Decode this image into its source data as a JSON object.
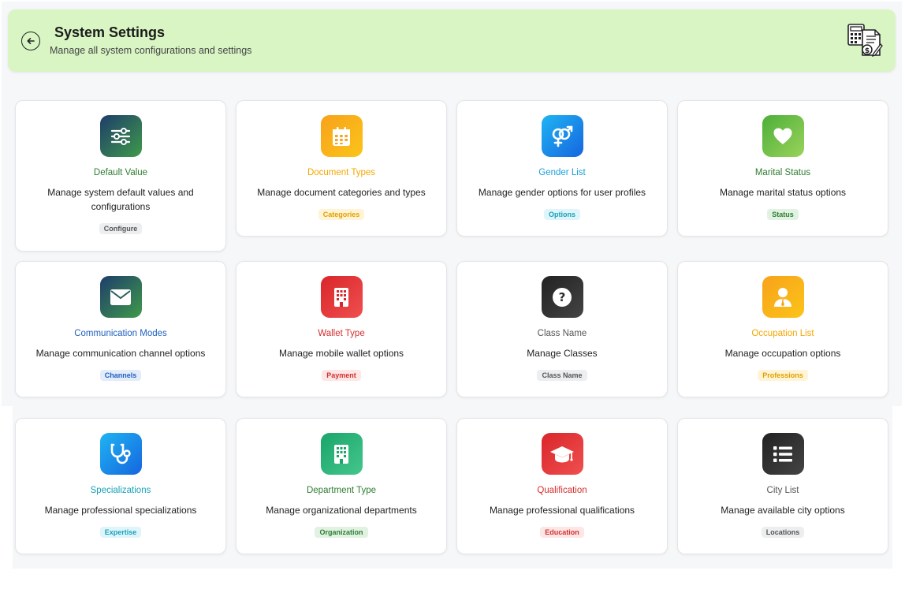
{
  "header": {
    "title": "System Settings",
    "subtitle": "Manage all system configurations and settings"
  },
  "cards": [
    {
      "title": "Default Value",
      "desc": "Manage system default values and configurations",
      "badge": "Configure",
      "color": "#2e7d32",
      "icon": "sliders-icon"
    },
    {
      "title": "Document Types",
      "desc": "Manage document categories and types",
      "badge": "Categories",
      "color": "#f5a700",
      "icon": "calendar-icon"
    },
    {
      "title": "Gender List",
      "desc": "Manage gender options for user profiles",
      "badge": "Options",
      "color": "#1aa0d8",
      "icon": "gender-icon"
    },
    {
      "title": "Marital Status",
      "desc": "Manage marital status options",
      "badge": "Status",
      "color": "#2e7d32",
      "icon": "heart-icon"
    },
    {
      "title": "Communication Modes",
      "desc": "Manage communication channel options",
      "badge": "Channels",
      "color": "#1f5fbf",
      "icon": "envelope-icon"
    },
    {
      "title": "Wallet Type",
      "desc": "Manage mobile wallet options",
      "badge": "Payment",
      "color": "#d32f2f",
      "icon": "building-icon"
    },
    {
      "title": "Class Name",
      "desc": "Manage Classes",
      "badge": "Class Name",
      "color": "#555555",
      "icon": "question-icon"
    },
    {
      "title": "Occupation List",
      "desc": "Manage occupation options",
      "badge": "Professions",
      "color": "#f5a700",
      "icon": "user-tie-icon"
    },
    {
      "title": "Specializations",
      "desc": "Manage professional specializations",
      "badge": "Expertise",
      "color": "#17a2b8",
      "icon": "stethoscope-icon"
    },
    {
      "title": "Department Type",
      "desc": "Manage organizational departments",
      "badge": "Organization",
      "color": "#2e7d32",
      "icon": "office-icon"
    },
    {
      "title": "Qualification",
      "desc": "Manage professional qualifications",
      "badge": "Education",
      "color": "#d32f2f",
      "icon": "graduation-cap-icon"
    },
    {
      "title": "City List",
      "desc": "Manage available city options",
      "badge": "Locations",
      "color": "#555555",
      "icon": "list-icon"
    }
  ]
}
